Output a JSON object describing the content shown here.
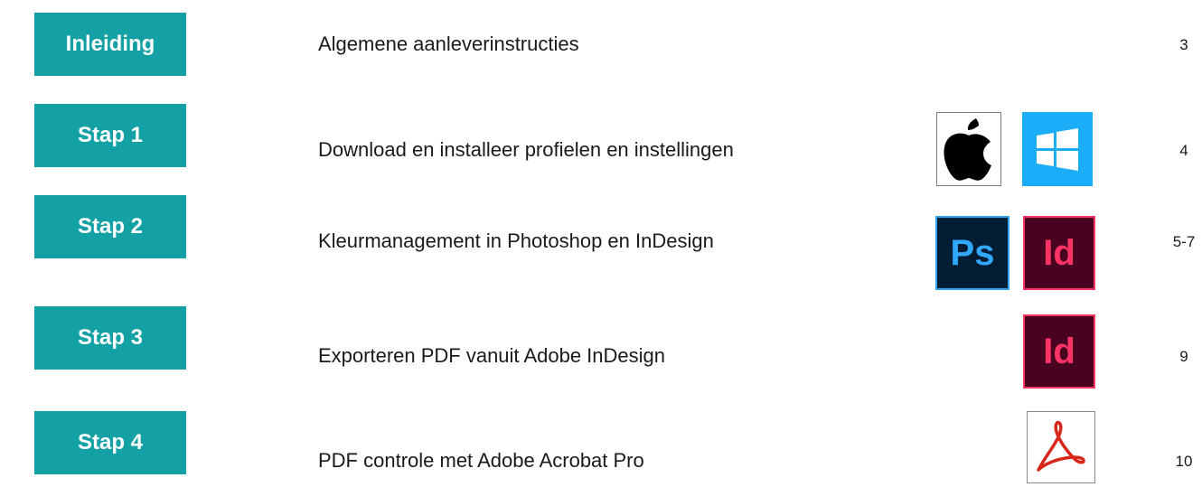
{
  "toc": [
    {
      "step": "Inleiding",
      "title": "Algemene aanleverinstructies",
      "page": "3",
      "icons": []
    },
    {
      "step": "Stap 1",
      "title": "Download en installeer profielen en instellingen",
      "page": "4",
      "icons": [
        "apple-icon",
        "windows-icon"
      ]
    },
    {
      "step": "Stap 2",
      "title": "Kleurmanagement in Photoshop en InDesign",
      "page": "5-7",
      "icons": [
        "photoshop-icon",
        "indesign-icon"
      ]
    },
    {
      "step": "Stap 3",
      "title": "Exporteren PDF vanuit Adobe InDesign",
      "page": "9",
      "icons": [
        "indesign-icon"
      ]
    },
    {
      "step": "Stap 4",
      "title": "PDF controle met Adobe Acrobat Pro",
      "page": "10",
      "icons": [
        "acrobat-icon"
      ]
    }
  ],
  "icon_labels": {
    "photoshop": "Ps",
    "indesign": "Id"
  },
  "colors": {
    "step_bg": "#13a1a6",
    "windows": "#1badf8",
    "photoshop_bg": "#001d34",
    "photoshop_fg": "#31a8ff",
    "indesign_bg": "#49021f",
    "indesign_fg": "#ff3366",
    "acrobat": "#d7271b"
  }
}
